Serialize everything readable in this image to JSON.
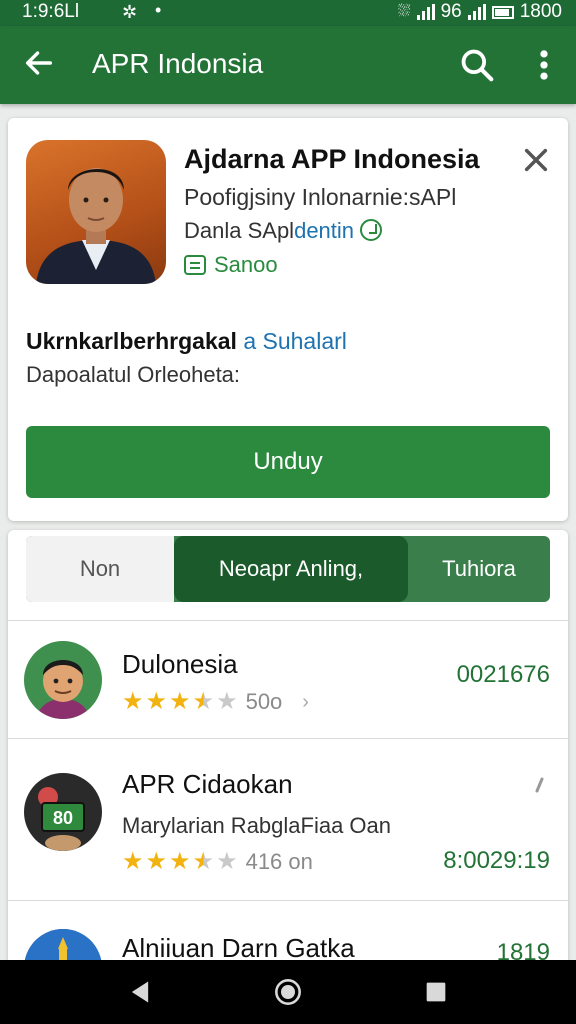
{
  "status_bar": {
    "time": "1:9:6Ll",
    "right_text": "96",
    "right_time": "1800"
  },
  "app_bar": {
    "title": "APR Indonsia"
  },
  "app_card": {
    "name": "Ajdarna APP Indonesia",
    "subtitle": "Poofigjsiny Inlonarnie:sAPl",
    "developer_prefix": "Danla SApl",
    "developer_accent": "dentin",
    "badge_label": "Sanoo",
    "heading": "Ukrnkarlberhrgakal",
    "heading_link": "a Suhalarl",
    "description": "Dapoalatul Orleoheta:",
    "install_label": "Unduy"
  },
  "tabs": [
    {
      "label": "Non"
    },
    {
      "label": "Neoapr Anling,"
    },
    {
      "label": "Tuhiora"
    }
  ],
  "list_items": [
    {
      "name": "Dulonesia",
      "line2": "",
      "rating": 3.5,
      "rating_count": "50o",
      "value": "0021676"
    },
    {
      "name": "APR Cidaokan",
      "line2": "Marylarian RabglaFiaa Oan",
      "rating": 3.5,
      "rating_count": "416 on",
      "value": "8:0029:19"
    },
    {
      "name": "Alniiuan Darn Gatka",
      "line2": "",
      "rating": 0,
      "rating_count": "",
      "value": "1819"
    }
  ],
  "icons": {
    "back": "arrow-left-icon",
    "search": "search-icon",
    "more": "more-vert-icon",
    "close": "close-icon"
  },
  "colors": {
    "primary": "#237236",
    "accent_button": "#2b8a3e",
    "tab_active": "#1b5a2b",
    "star": "#f2b311"
  }
}
